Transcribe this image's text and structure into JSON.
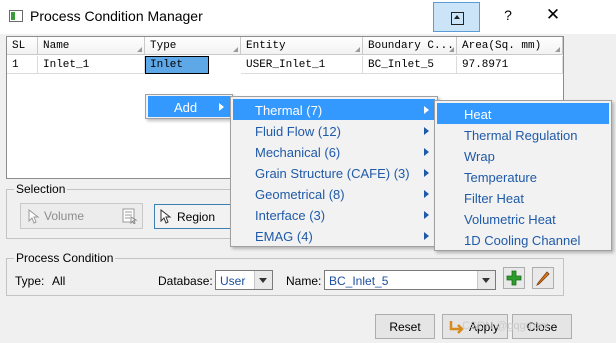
{
  "window": {
    "title": "Process Condition Manager"
  },
  "table": {
    "headers": [
      "SL",
      "Name",
      "Type",
      "Entity",
      "Boundary C...",
      "Area(Sq. mm)"
    ],
    "rows": [
      [
        "1",
        "Inlet_1",
        "Inlet",
        "USER_Inlet_1",
        "BC_Inlet_5",
        "97.8971"
      ]
    ]
  },
  "context_menu": {
    "items": [
      {
        "label": "Add",
        "has_submenu": true
      }
    ]
  },
  "add_submenu": {
    "items": [
      {
        "label": "Thermal (7)",
        "selected": true
      },
      {
        "label": "Fluid Flow (12)"
      },
      {
        "label": "Mechanical (6)"
      },
      {
        "label": "Grain Structure (CAFE) (3)"
      },
      {
        "label": "Geometrical (8)"
      },
      {
        "label": "Interface (3)"
      },
      {
        "label": "EMAG (4)"
      }
    ]
  },
  "thermal_submenu": {
    "items": [
      {
        "label": "Heat",
        "selected": true
      },
      {
        "label": "Thermal Regulation"
      },
      {
        "label": "Wrap"
      },
      {
        "label": "Temperature"
      },
      {
        "label": "Filter Heat"
      },
      {
        "label": "Volumetric Heat"
      },
      {
        "label": "1D Cooling Channel"
      }
    ]
  },
  "selection": {
    "legend": "Selection",
    "volume_label": "Volume",
    "region_label": "Region"
  },
  "process_condition": {
    "legend": "Process Condition",
    "type_label": "Type:",
    "type_value": "All",
    "database_label": "Database:",
    "database_value": "User",
    "name_label": "Name:",
    "name_value": "BC_Inlet_5"
  },
  "buttons": {
    "reset": "Reset",
    "apply": "Apply",
    "close": "Close"
  },
  "watermark": "CSDN @gqgqxxx",
  "colors": {
    "selection": "#3399ff",
    "menu_text": "#1f5aa8",
    "add_icon": "#2e9b2e",
    "edit_icon": "#e07a1f"
  }
}
